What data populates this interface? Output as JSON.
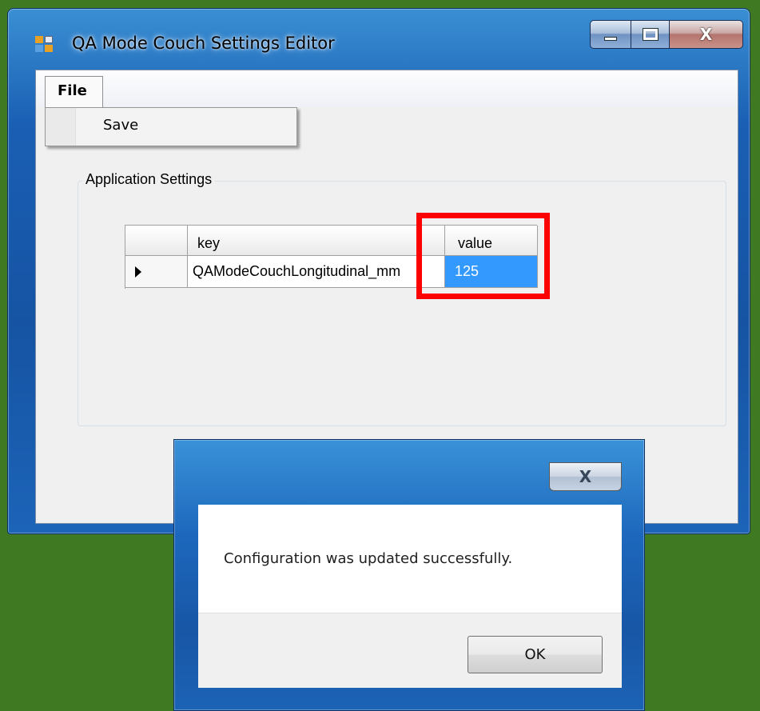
{
  "main_window": {
    "title": "QA Mode Couch Settings Editor",
    "icon": "app-form-icon",
    "caption_buttons": [
      "minimize",
      "maximize",
      "close"
    ],
    "close_glyph": "X"
  },
  "menu": {
    "file_label": "File",
    "items": [
      {
        "label": "Save"
      }
    ]
  },
  "group": {
    "label": "Application Settings"
  },
  "grid": {
    "columns": [
      "key",
      "value"
    ],
    "rows": [
      {
        "key": "QAModeCouchLongitudinal_mm",
        "value": "125",
        "selected_cell": "value"
      }
    ]
  },
  "annotation": {
    "color": "#ff0000",
    "target": "value column"
  },
  "dialog": {
    "close_glyph": "X",
    "message": "Configuration was updated successfully.",
    "ok_label": "OK"
  },
  "colors": {
    "desktop": "#3f7a23",
    "selection": "#3399ff",
    "highlight": "#ff0000"
  }
}
